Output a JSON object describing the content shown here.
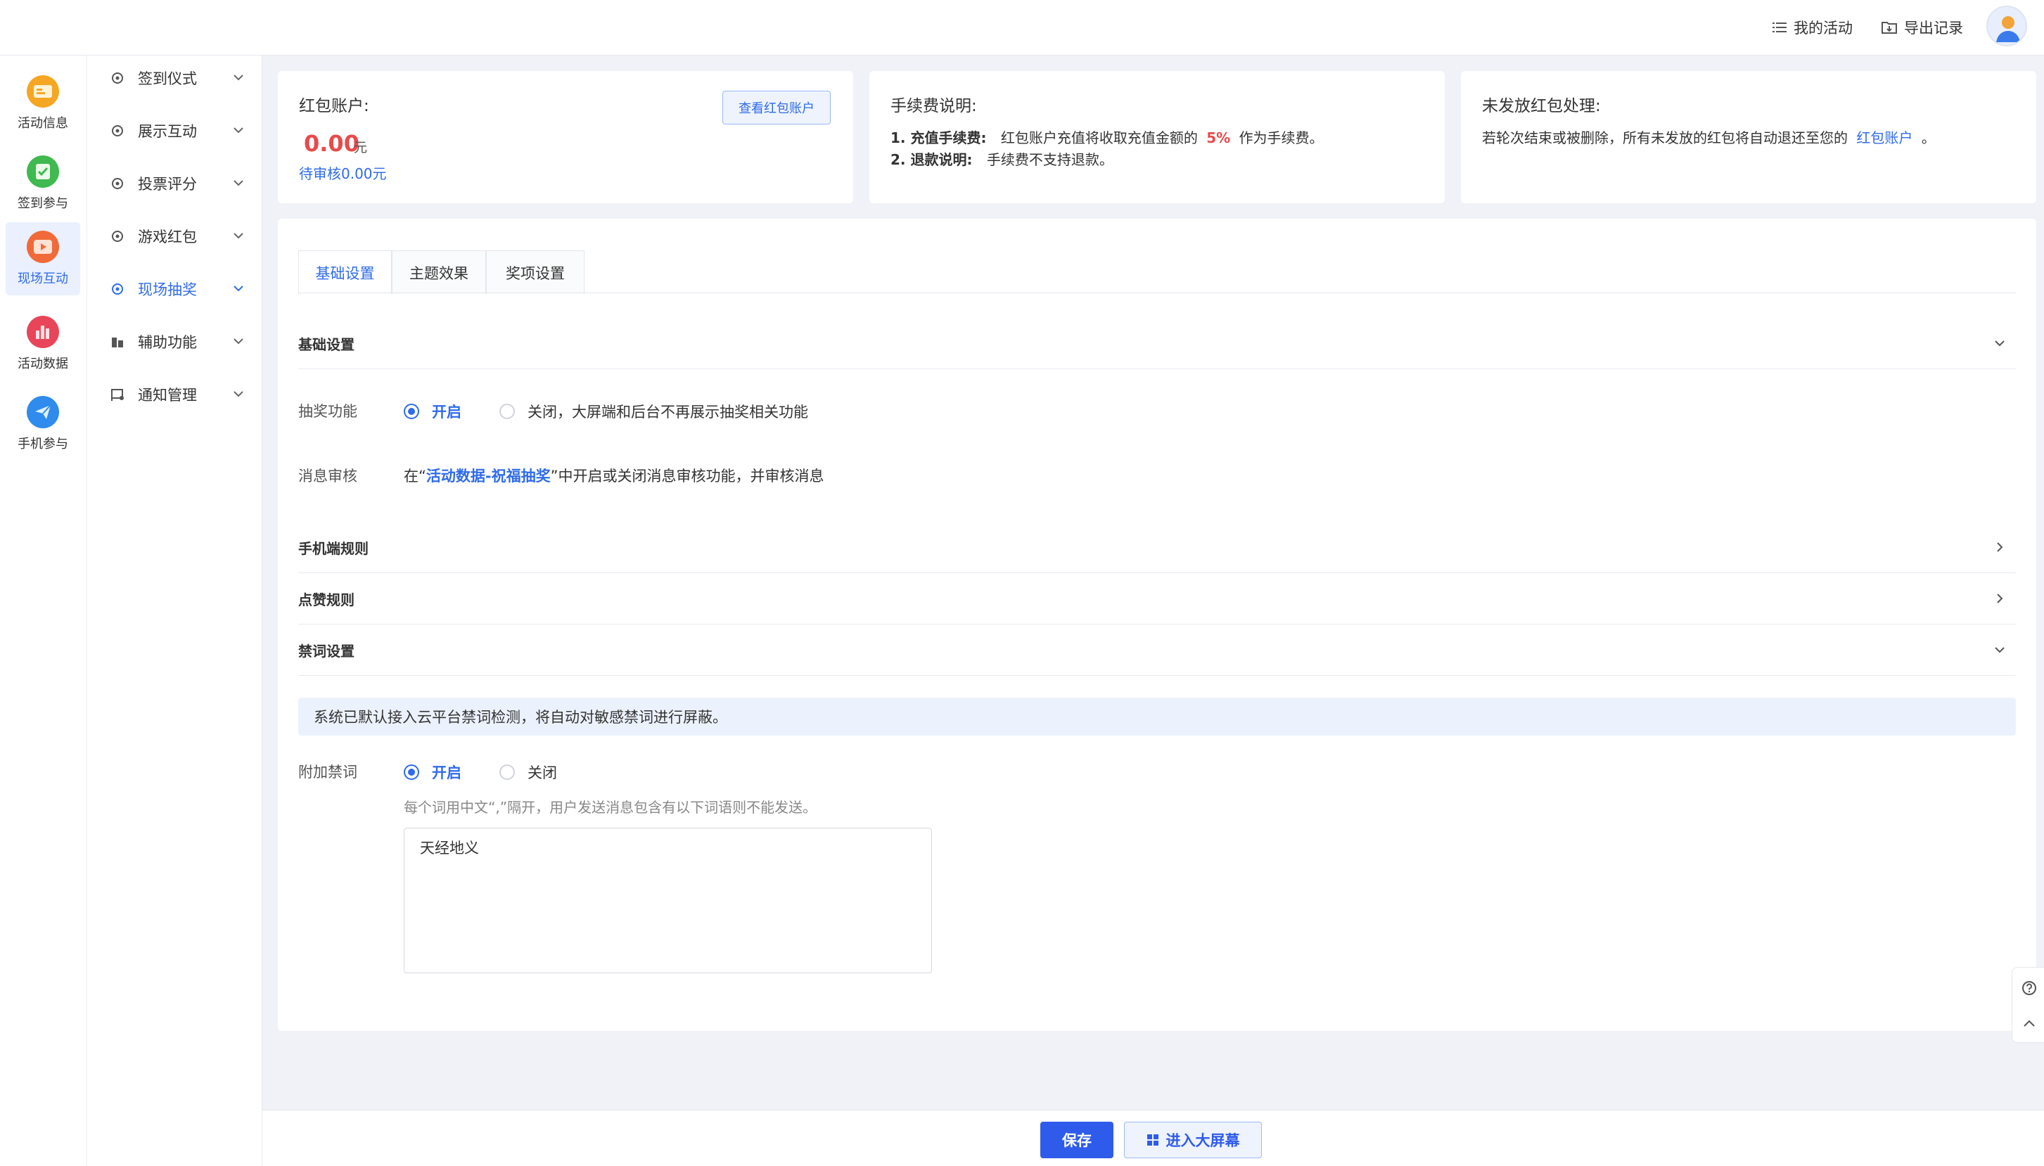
{
  "topbar": {
    "my_activity": "我的活动",
    "export_records": "导出记录"
  },
  "rail": {
    "items": [
      {
        "label": "活动信息",
        "icon": "card-icon",
        "color": "#f5a623"
      },
      {
        "label": "签到参与",
        "icon": "check-icon",
        "color": "#3fb950"
      },
      {
        "label": "现场互动",
        "icon": "play-icon",
        "color": "#f06a3a"
      },
      {
        "label": "活动数据",
        "icon": "bar-chart-icon",
        "color": "#e8455a"
      },
      {
        "label": "手机参与",
        "icon": "paper-plane-icon",
        "color": "#2f8bec"
      }
    ],
    "active_index": 2
  },
  "submenu": {
    "items": [
      {
        "label": "签到仪式",
        "icon": "gear-icon"
      },
      {
        "label": "展示互动",
        "icon": "gear-icon"
      },
      {
        "label": "投票评分",
        "icon": "gear-icon"
      },
      {
        "label": "游戏红包",
        "icon": "gear-icon"
      },
      {
        "label": "现场抽奖",
        "icon": "gear-icon"
      },
      {
        "label": "辅助功能",
        "icon": "building-icon"
      },
      {
        "label": "通知管理",
        "icon": "notice-icon"
      }
    ],
    "active_index": 4
  },
  "redpacket": {
    "title": "红包账户:",
    "amount": "0.00",
    "unit": "元",
    "pending": "待审核0.00元",
    "view_button": "查看红包账户"
  },
  "fee": {
    "title": "手续费说明:",
    "line1_label": "1. 充值手续费:",
    "line1_text_a": "红包账户充值将收取充值金额的",
    "line1_rate": "5%",
    "line1_text_b": "作为手续费。",
    "line2_label": "2. 退款说明:",
    "line2_text": "手续费不支持退款。"
  },
  "unsent": {
    "title": "未发放红包处理:",
    "text": "若轮次结束或被删除，所有未发放的红包将自动退还至您的",
    "link": "红包账户",
    "tail": "。"
  },
  "tabs": [
    "基础设置",
    "主题效果",
    "奖项设置"
  ],
  "sections": {
    "basic": "基础设置",
    "mobile_rules": "手机端规则",
    "like_rules": "点赞规则",
    "banned_words": "禁词设置"
  },
  "lottery": {
    "label": "抽奖功能",
    "on": "开启",
    "off": "关闭，大屏端和后台不再展示抽奖相关功能"
  },
  "review": {
    "label": "消息审核",
    "prefix": "在“",
    "link": "活动数据-祝福抽奖",
    "suffix": "”中开启或关闭消息审核功能，并审核消息"
  },
  "notice": "系统已默认接入云平台禁词检测，将自动对敏感禁词进行屏蔽。",
  "extra_words": {
    "label": "附加禁词",
    "on": "开启",
    "off": "关闭",
    "hint": "每个词用中文“,”隔开，用户发送消息包含有以下词语则不能发送。",
    "value": "天经地义"
  },
  "footer": {
    "save": "保存",
    "big_screen": "进入大屏幕"
  },
  "colors": {
    "accent": "#2f6bec",
    "danger": "#e84a4a"
  }
}
